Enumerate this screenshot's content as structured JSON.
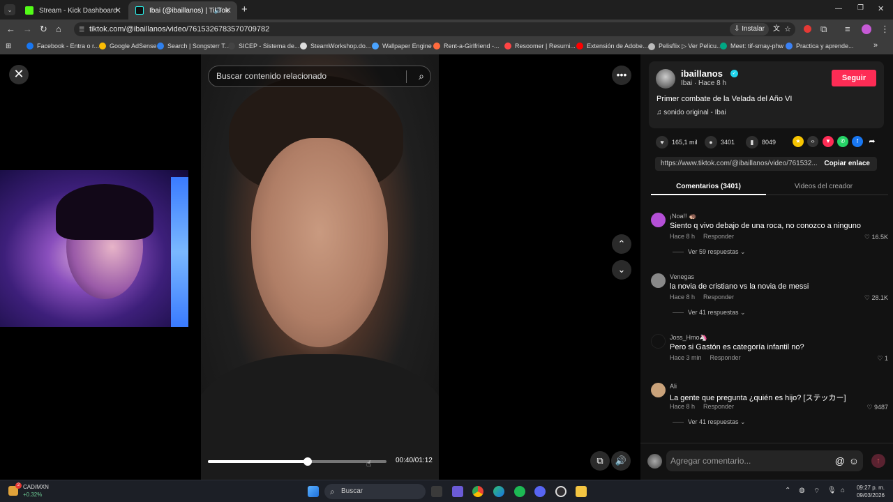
{
  "browser": {
    "tabs": [
      {
        "title": "Stream - Kick Dashboard",
        "close": "✕"
      },
      {
        "title": "Ibai (@ibaillanos) | TikTok",
        "close": "✕"
      }
    ],
    "new_tab": "+",
    "window_controls": {
      "minimize": "—",
      "maximize": "❐",
      "close": "✕"
    },
    "url": "tiktok.com/@ibaillanos/video/7615326783570709782",
    "install_label": "Instalar",
    "bookmarks": [
      "Facebook - Entra o r...",
      "Google AdSense",
      "Search | Songsterr T...",
      "SICEP - Sistema de...",
      "SteamWorkshop.do...",
      "Wallpaper Engine",
      "Rent-a-Girlfriend -...",
      "Resoomer | Resumi...",
      "Extensión de Adobe...",
      "Pelisflix ▷ Ver Pelicu...",
      "Meet: tif-smay-phw",
      "Practica y aprende..."
    ],
    "bookmark_colors": [
      "#1877f2",
      "#fbbc04",
      "#2f80ed",
      "#444444",
      "#dddddd",
      "#4aa3ff",
      "#ff6a3d",
      "#ff4444",
      "#ff0000",
      "#bbbbbb",
      "#00a884",
      "#3b82f6"
    ]
  },
  "video": {
    "search_placeholder": "Buscar contenido relacionado",
    "close_icon": "✕",
    "more_icon": "•••",
    "up_icon": "⌃",
    "down_icon": "⌄",
    "progress": 0.557,
    "time": "00:40/01:12",
    "volume_icon": "🔊",
    "pip_icon": "⧉"
  },
  "author": {
    "username": "ibaillanos",
    "display_name": "Ibai · Hace 8 h",
    "follow_label": "Seguir",
    "description": "Primer combate de la Velada del Año VI",
    "music": "♫  sonido original - Ibai"
  },
  "stats": {
    "likes": "165,1 mil",
    "comments": "3401",
    "saves": "8049"
  },
  "share_colors": [
    "#f6c400",
    "#333333",
    "#fe2c55",
    "#25d366",
    "#1877f2",
    "#121212"
  ],
  "share_link": "https://www.tiktok.com/@ibaillanos/video/761532...",
  "copy_label": "Copiar enlace",
  "panel_tabs": [
    "Comentarios (3401)",
    "Videos del creador"
  ],
  "comments": [
    {
      "user": "¡Noa!! 🦔",
      "text": "Siento q vivo debajo de una roca, no conozco a ninguno",
      "time": "Hace 8 h",
      "reply": "Responder",
      "likes": "♡ 16.5K",
      "replies": "Ver 59 respuestas ⌄",
      "avatar_color": "#b44fd6"
    },
    {
      "user": "Venegas",
      "text": "la novia de cristiano vs la novia de messi",
      "time": "Hace 8 h",
      "reply": "Responder",
      "likes": "♡ 28.1K",
      "replies": "Ver 41 respuestas ⌄",
      "avatar_color": "#888888"
    },
    {
      "user": "Joss_Hmo🦄",
      "text": "Pero si Gastón es categoría infantil no?",
      "time": "Hace 3 min",
      "reply": "Responder",
      "likes": "♡ 1",
      "replies": "",
      "avatar_color": "#111111"
    },
    {
      "user": "Ali",
      "text": "La gente que pregunta ¿quién es hijo? [ステッカー]",
      "time": "Hace 8 h",
      "reply": "Responder",
      "likes": "♡ 9487",
      "replies": "Ver 41 respuestas ⌄",
      "avatar_color": "#c9a27a"
    }
  ],
  "comment_box": {
    "placeholder": "Agregar comentario...",
    "at_icon": "@",
    "emoji_icon": "☺",
    "post_icon": "↑"
  },
  "taskbar": {
    "currency": "CAD/MXN",
    "change": "+0.32%",
    "search_label": "Buscar",
    "time": "09:27 p. m.",
    "date": "09/03/2026",
    "notification_count": "2"
  }
}
